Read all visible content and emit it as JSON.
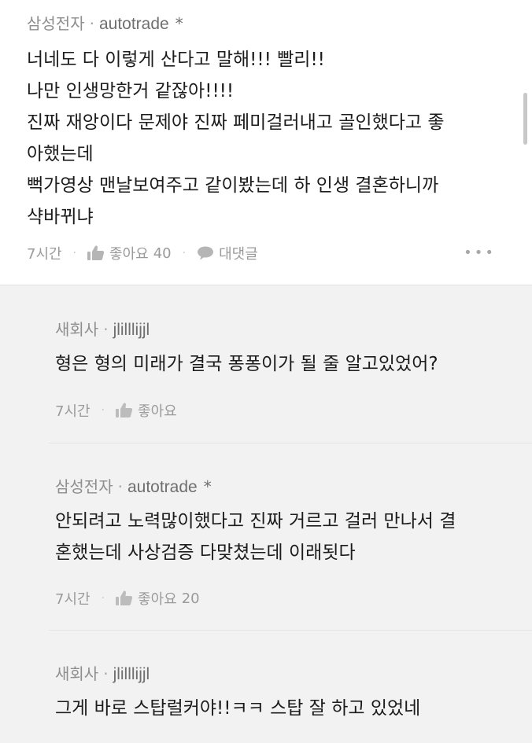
{
  "main": {
    "company": "삼성전자",
    "nickname": "autotrade",
    "badge": "*",
    "lines": [
      "너네도 다 이렇게 산다고 말해!!! 빨리!!",
      "나만 인생망한거 같잖아!!!!",
      "진짜 재앙이다 문제야 진짜 페미걸러내고 골인했다고 좋",
      "아했는데",
      "뻑가영상 맨날보여주고 같이봤는데 하 인생 결혼하니까",
      "샥바뀌냐"
    ],
    "time": "7시간",
    "like_label": "좋아요",
    "like_count": "40",
    "reply_label": "대댓글",
    "more": "•••"
  },
  "replies": [
    {
      "company": "새회사",
      "nickname": "jlilllijjl",
      "badge": "",
      "lines": [
        "형은 형의 미래가 결국 퐁퐁이가 될 줄 알고있었어?"
      ],
      "time": "7시간",
      "like_label": "좋아요",
      "like_count": ""
    },
    {
      "company": "삼성전자",
      "nickname": "autotrade",
      "badge": "*",
      "lines": [
        "안되려고 노력많이했다고 진짜 거르고 걸러 만나서 결",
        "혼했는데 사상검증 다맞쳤는데 이래됫다"
      ],
      "time": "7시간",
      "like_label": "좋아요",
      "like_count": "20"
    },
    {
      "company": "새회사",
      "nickname": "jlilllijjl",
      "badge": "",
      "lines": [
        "그게 바로 스탑럴커야!!ㅋㅋ 스탑 잘 하고 있었네"
      ],
      "time": "",
      "like_label": "",
      "like_count": ""
    }
  ],
  "colors": {
    "reply_bg": "#f2f2f2",
    "meta_text": "#8e8e8e",
    "body_text": "#1c1c1c"
  },
  "icons": {
    "like": "thumbs-up-icon",
    "reply": "speech-bubble-icon",
    "more": "more-dots-icon"
  }
}
